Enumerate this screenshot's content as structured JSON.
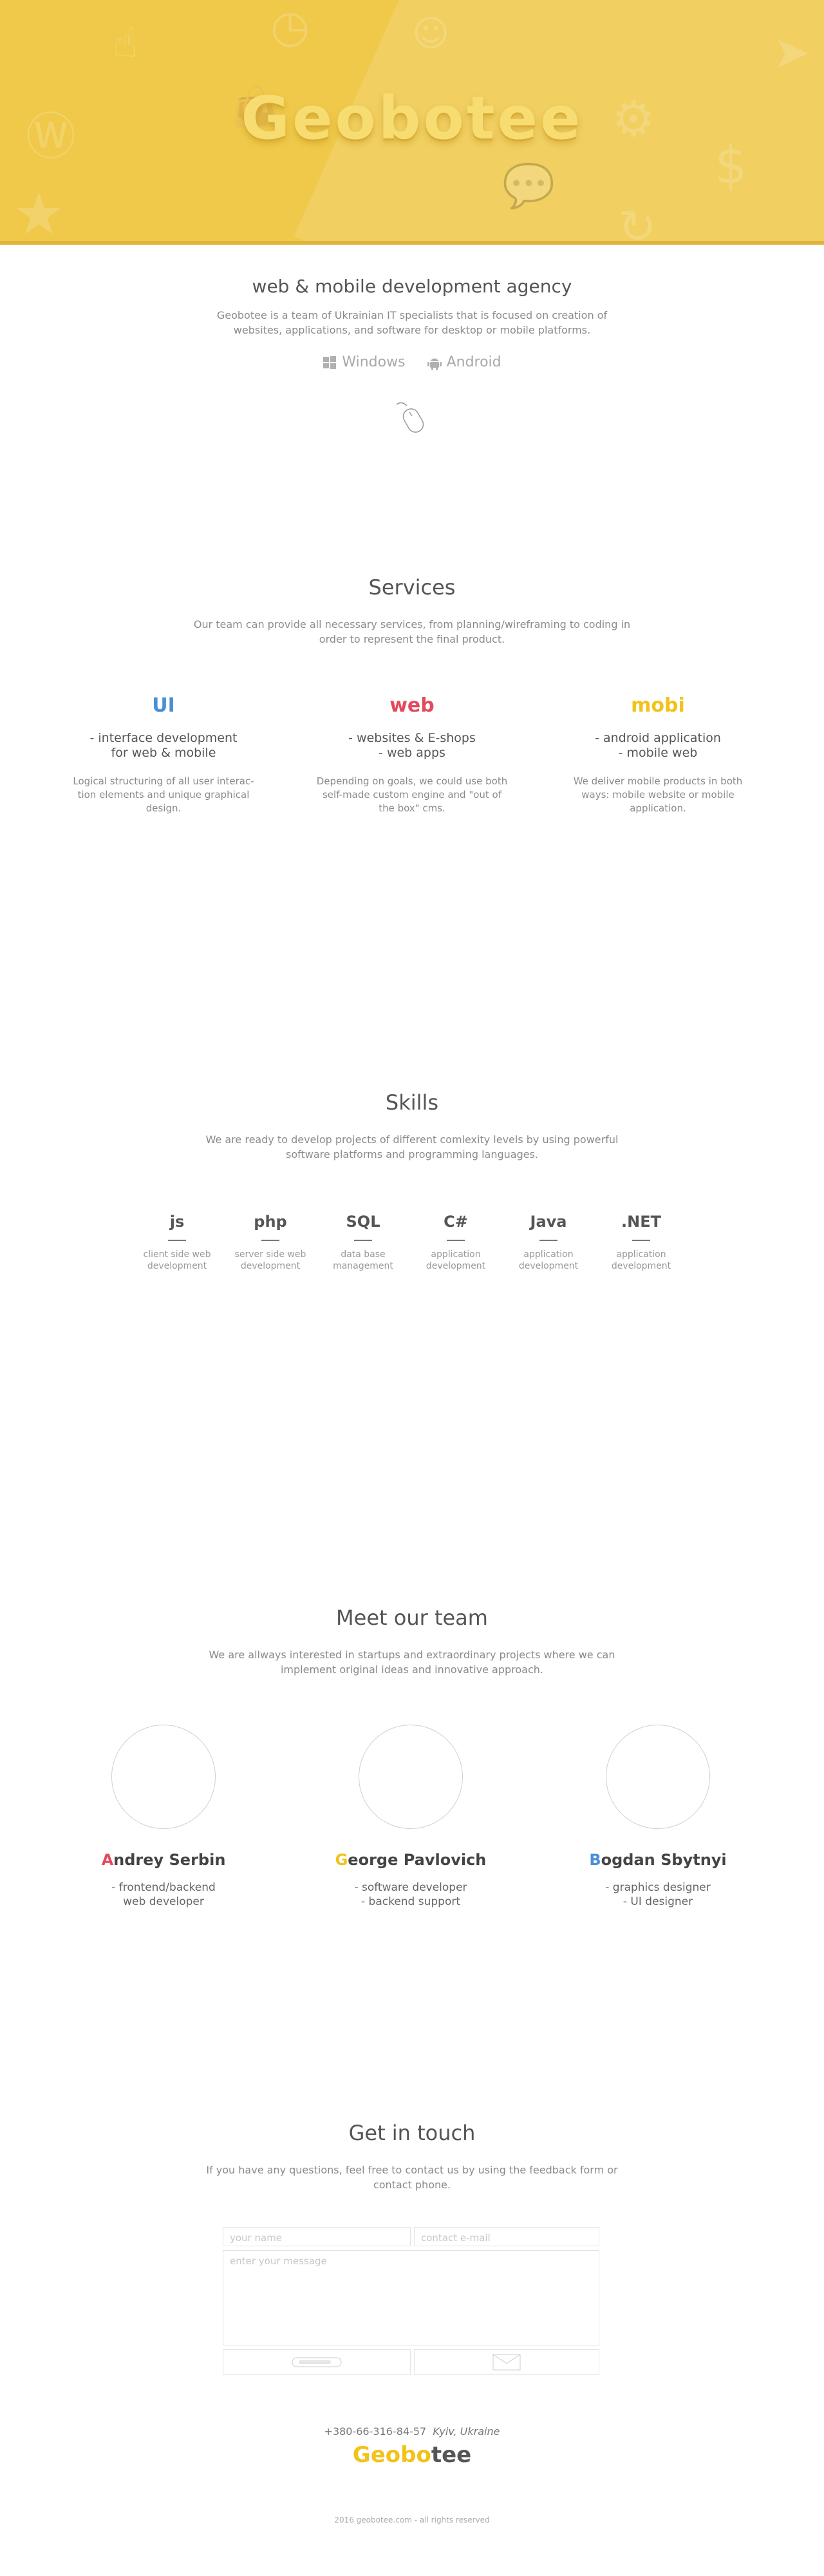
{
  "hero": {
    "logo": "Geobotee"
  },
  "intro": {
    "tagline": "web & mobile development agency",
    "description": "Geobotee is a team of Ukrainian IT specialists that is focused on creation of websites, applications, and software for desktop or mobile platforms.",
    "platforms": [
      {
        "label": "Windows",
        "icon": "windows-icon"
      },
      {
        "label": "Android",
        "icon": "android-icon"
      }
    ],
    "scroll_icon": "mouse-icon"
  },
  "services": {
    "title": "Services",
    "lead": "Our team can provide all necessary services, from planning/wireframing to coding in order to represent the final product.",
    "items": [
      {
        "title": "UI",
        "color": "#4a90d9",
        "sub1": "- interface development",
        "sub2": "for web & mobile",
        "desc": "Logical structuring of all user interac- tion elements and unique graphical design."
      },
      {
        "title": "web",
        "color": "#e4495c",
        "sub1": "- websites & E-shops",
        "sub2": "- web apps",
        "desc": "Depending on goals, we could use both self-made custom engine and \"out of the box\" cms."
      },
      {
        "title": "mobi",
        "color": "#f2c21a",
        "sub1": "- android application",
        "sub2": "- mobile web",
        "desc": "We deliver mobile products in both ways: mobile website or mobile application."
      }
    ]
  },
  "skills": {
    "title": "Skills",
    "lead": "We are ready to develop projects of different comlexity levels by using powerful software platforms and programming languages.",
    "items": [
      {
        "name": "js",
        "d1": "client side web",
        "d2": "development"
      },
      {
        "name": "php",
        "d1": "server side web",
        "d2": "development"
      },
      {
        "name": "SQL",
        "d1": "data base",
        "d2": "management"
      },
      {
        "name": "C#",
        "d1": "application",
        "d2": "development"
      },
      {
        "name": "Java",
        "d1": "application",
        "d2": "development"
      },
      {
        "name": ".NET",
        "d1": "application",
        "d2": "development"
      }
    ]
  },
  "team": {
    "title": "Meet our team",
    "lead": "We are allways interested in startups and extraordinary projects where we can implement original ideas and innovative approach.",
    "members": [
      {
        "initial": "A",
        "rest": "ndrey Serbin",
        "color": "#e4495c",
        "r1": "- frontend/backend",
        "r2": "web developer"
      },
      {
        "initial": "G",
        "rest": "eorge Pavlovich",
        "color": "#f2c21a",
        "r1": "- software developer",
        "r2": "- backend support"
      },
      {
        "initial": "B",
        "rest": "ogdan Sbytnyi",
        "color": "#4a90d9",
        "r1": "- graphics designer",
        "r2": "- UI designer"
      }
    ]
  },
  "contact": {
    "title": "Get in touch",
    "lead": "If you have any questions, feel free to contact us by using the feedback form or contact phone.",
    "name_placeholder": "your name",
    "email_placeholder": "contact e-mail",
    "message_placeholder": "enter your message"
  },
  "footer": {
    "phone": "+380-66-316-84-57",
    "city": "Kyiv, Ukraine",
    "logo_a": "Geobo",
    "logo_b": "tee",
    "logo_color": "#f2c21a",
    "copyright": "2016 geobotee.com - all rights reserved"
  }
}
